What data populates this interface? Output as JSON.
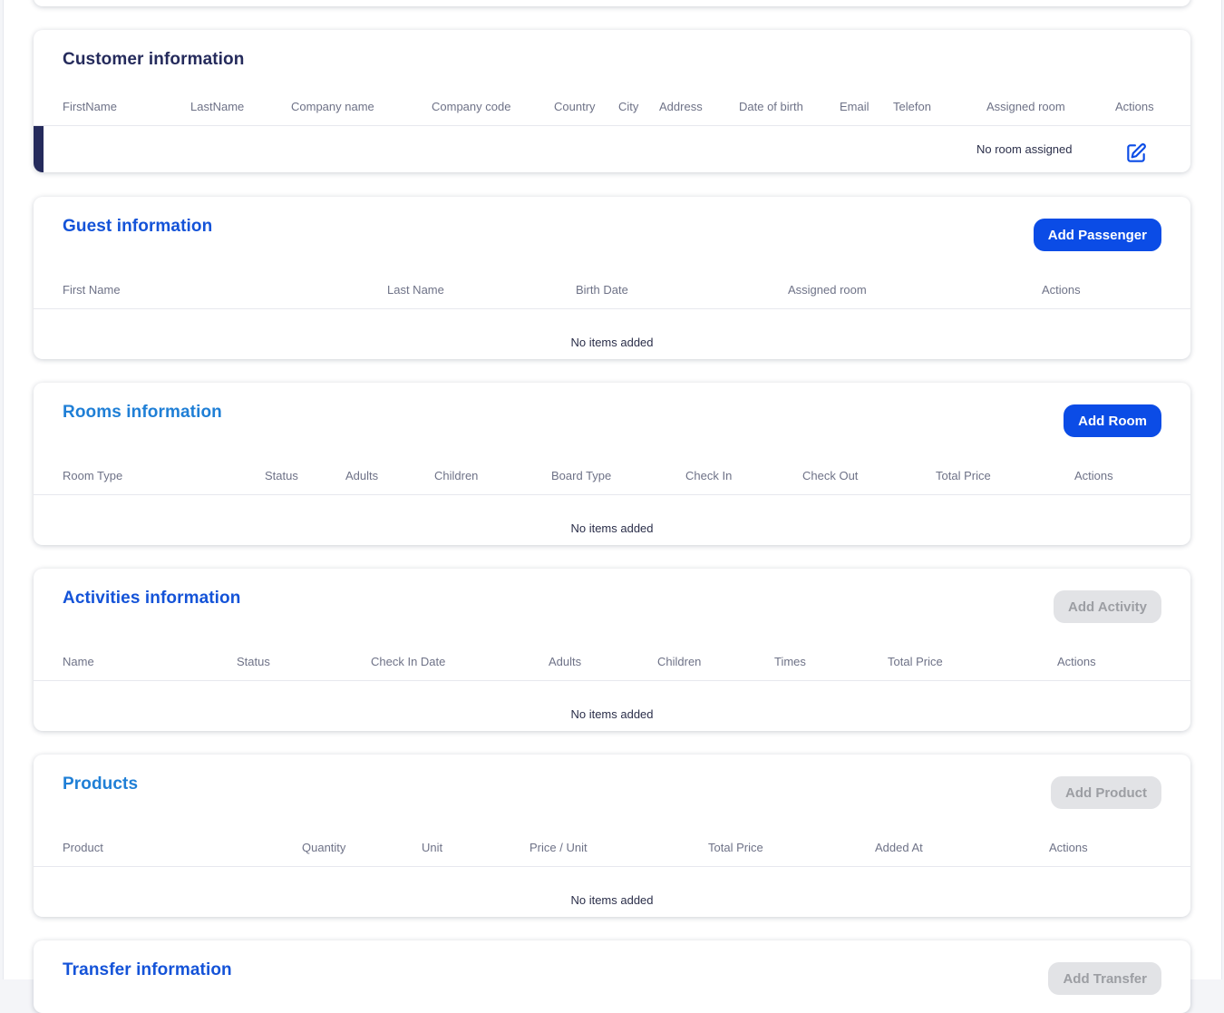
{
  "customer": {
    "title": "Customer information",
    "columns": [
      "FirstName",
      "LastName",
      "Company name",
      "Company code",
      "Country",
      "City",
      "Address",
      "Date of birth",
      "Email",
      "Telefon",
      "Assigned room",
      "Actions"
    ],
    "row": {
      "assigned_room": "No room assigned",
      "action_icon": "edit-icon"
    }
  },
  "guest": {
    "title": "Guest information",
    "button": "Add Passenger",
    "columns": [
      "First Name",
      "Last Name",
      "Birth Date",
      "Assigned room",
      "Actions"
    ],
    "empty": "No items added"
  },
  "rooms": {
    "title": "Rooms information",
    "button": "Add Room",
    "columns": [
      "Room Type",
      "Status",
      "Adults",
      "Children",
      "Board Type",
      "Check In",
      "Check Out",
      "Total Price",
      "Actions"
    ],
    "empty": "No items added"
  },
  "activities": {
    "title": "Activities information",
    "button": "Add Activity",
    "columns": [
      "Name",
      "Status",
      "Check In Date",
      "Adults",
      "Children",
      "Times",
      "Total Price",
      "Actions"
    ],
    "empty": "No items added"
  },
  "products": {
    "title": "Products",
    "button": "Add Product",
    "columns": [
      "Product",
      "Quantity",
      "Unit",
      "Price / Unit",
      "Total Price",
      "Added At",
      "Actions"
    ],
    "empty": "No items added"
  },
  "transfer": {
    "title": "Transfer information",
    "button": "Add Transfer"
  },
  "colors": {
    "primary": "#0b4ce6",
    "title_dark": "#252b5c",
    "title_blue": "#1453d8",
    "title_sky": "#1f7fd6",
    "disabled_bg": "#e2e3e6"
  }
}
